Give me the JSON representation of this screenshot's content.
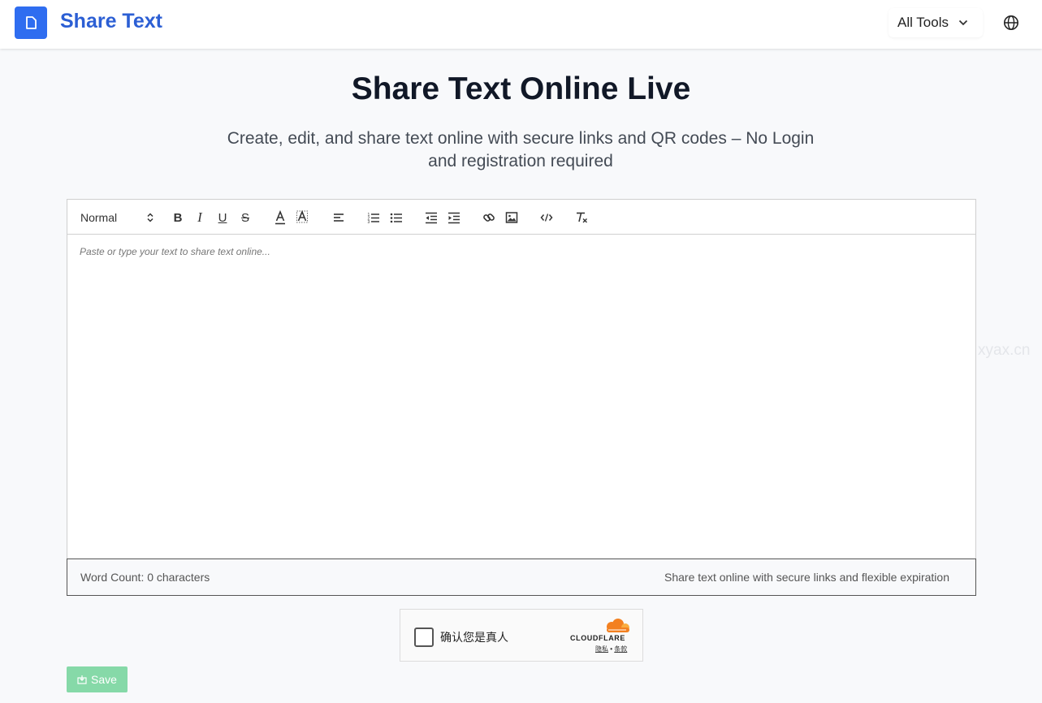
{
  "header": {
    "brand": "Share Text",
    "tools_label": "All Tools"
  },
  "hero": {
    "title": "Share Text Online Live",
    "subtitle": "Create, edit, and share text online with secure links and QR codes – No Login and registration required"
  },
  "editor": {
    "heading_select": "Normal",
    "toolbar_icons": [
      "bold-icon",
      "italic-icon",
      "underline-icon",
      "strike-icon",
      "text-color-icon",
      "background-color-icon",
      "align-icon",
      "ordered-list-icon",
      "bullet-list-icon",
      "outdent-icon",
      "indent-icon",
      "link-icon",
      "image-icon",
      "code-icon",
      "clear-format-icon"
    ],
    "placeholder": "Paste or type your text to share text online...",
    "word_count": "Word Count: 0 characters",
    "footer_note": "Share text online with secure links and flexible expiration"
  },
  "captcha": {
    "label": "确认您是真人",
    "brand": "CLOUDFLARE",
    "privacy": "隐私",
    "separator": "•",
    "terms": "条款"
  },
  "actions": {
    "save_label": "Save"
  },
  "watermark": "xyax.cn",
  "colors": {
    "brand": "#2c5fd4",
    "logo_bg": "#2f6df0",
    "save_bg": "#86d9a8",
    "cloudflare": "#f38020"
  }
}
